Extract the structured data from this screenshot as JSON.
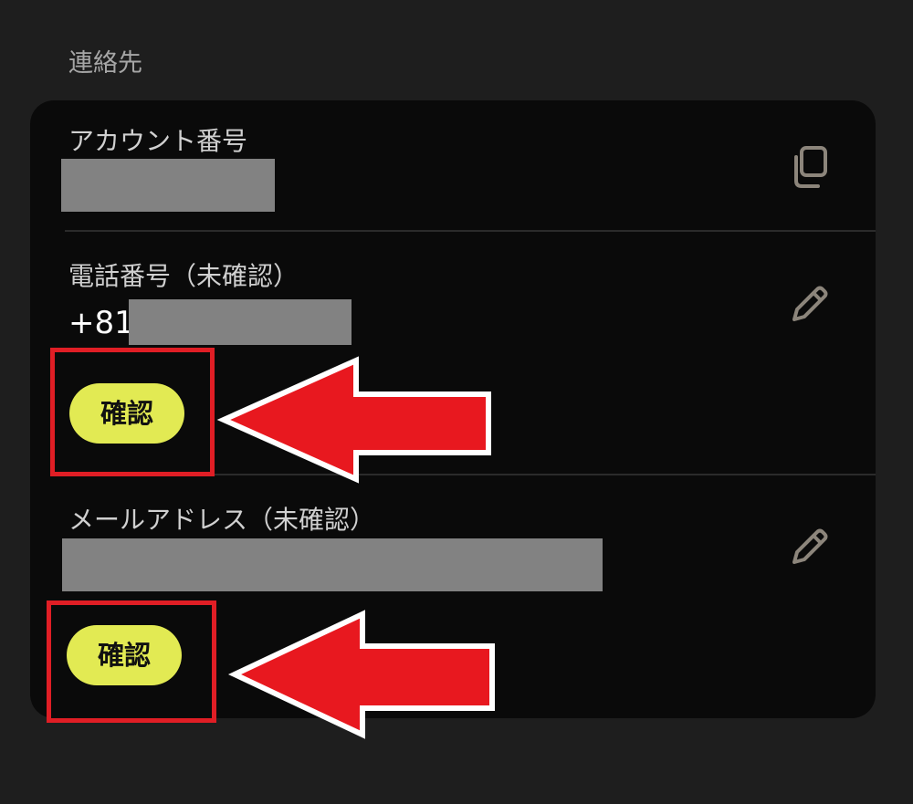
{
  "section": {
    "title": "連絡先"
  },
  "account": {
    "label": "アカウント番号",
    "value_redacted": true,
    "action_icon": "copy-icon"
  },
  "phone": {
    "label": "電話番号（未確認）",
    "prefix": "+81",
    "value_redacted": true,
    "action_icon": "pencil-icon",
    "confirm_label": "確認"
  },
  "email": {
    "label": "メールアドレス（未確認）",
    "value_redacted": true,
    "action_icon": "pencil-icon",
    "confirm_label": "確認"
  },
  "annotations": {
    "highlight_color": "#e01e25",
    "arrow_color": "#e8181f"
  },
  "colors": {
    "background": "#1e1e1e",
    "card": "#0a0a0a",
    "confirm_button": "#e2ea53",
    "icon": "#8c857b"
  }
}
